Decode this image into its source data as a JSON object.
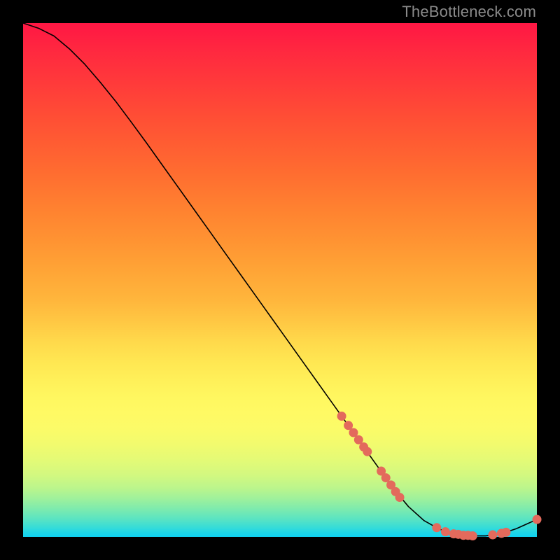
{
  "watermark": {
    "text": "TheBottleneck.com"
  },
  "colors": {
    "background": "#000000",
    "curve_stroke": "#000000",
    "marker_fill": "#e36a5c",
    "marker_stroke": "#b84d40"
  },
  "chart_data": {
    "type": "line",
    "title": "",
    "xlabel": "",
    "ylabel": "",
    "xlim": [
      0,
      100
    ],
    "ylim": [
      0,
      100
    ],
    "grid": false,
    "x": [
      0,
      3,
      6,
      9,
      12,
      15,
      18,
      21,
      24,
      27,
      30,
      33,
      36,
      39,
      42,
      45,
      48,
      51,
      54,
      57,
      60,
      63,
      66,
      69,
      72,
      75,
      78,
      81,
      84,
      87,
      90,
      93,
      96,
      100
    ],
    "values": [
      100,
      99,
      97.5,
      95,
      92,
      88.5,
      84.8,
      80.8,
      76.7,
      72.5,
      68.3,
      64.1,
      59.9,
      55.7,
      51.5,
      47.3,
      43.1,
      38.9,
      34.7,
      30.5,
      26.3,
      22.1,
      17.9,
      13.7,
      9.5,
      5.9,
      3.2,
      1.5,
      0.6,
      0.2,
      0.2,
      0.6,
      1.6,
      3.4
    ],
    "markers": [
      {
        "x": 62,
        "y": 23.5
      },
      {
        "x": 63.3,
        "y": 21.7
      },
      {
        "x": 64.3,
        "y": 20.3
      },
      {
        "x": 65.3,
        "y": 18.9
      },
      {
        "x": 66.3,
        "y": 17.5
      },
      {
        "x": 67.0,
        "y": 16.6
      },
      {
        "x": 69.7,
        "y": 12.8
      },
      {
        "x": 70.6,
        "y": 11.5
      },
      {
        "x": 71.6,
        "y": 10.1
      },
      {
        "x": 72.5,
        "y": 8.8
      },
      {
        "x": 73.3,
        "y": 7.7
      },
      {
        "x": 80.5,
        "y": 1.8
      },
      {
        "x": 82.2,
        "y": 1.0
      },
      {
        "x": 83.8,
        "y": 0.6
      },
      {
        "x": 84.7,
        "y": 0.5
      },
      {
        "x": 85.7,
        "y": 0.3
      },
      {
        "x": 86.6,
        "y": 0.3
      },
      {
        "x": 87.5,
        "y": 0.2
      },
      {
        "x": 91.4,
        "y": 0.4
      },
      {
        "x": 93.1,
        "y": 0.7
      },
      {
        "x": 94.0,
        "y": 0.9
      },
      {
        "x": 100.0,
        "y": 3.4
      }
    ]
  }
}
